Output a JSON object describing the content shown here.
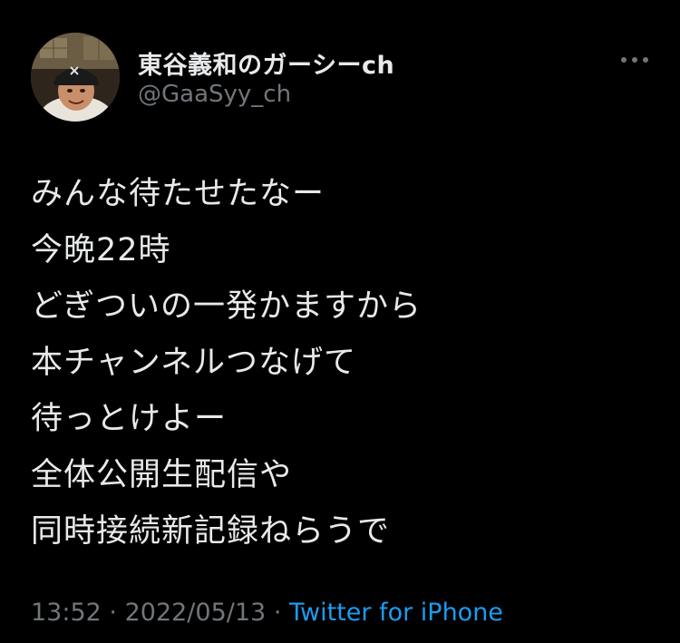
{
  "author": {
    "display_name": "東谷義和のガーシーch",
    "handle": "@GaaSyy_ch"
  },
  "tweet": {
    "lines": [
      "みんな待たせたなー",
      "今晩22時",
      "どぎついの一発かますから",
      "本チャンネルつなげて",
      "待っとけよー",
      "全体公開生配信や",
      "同時接続新記録ねらうで"
    ],
    "time": "13:52",
    "separator": "·",
    "date": "2022/05/13",
    "source": "Twitter for iPhone"
  },
  "icons": {
    "more": "more-horizontal-icon",
    "avatar": "avatar-photo"
  },
  "colors": {
    "background": "#000000",
    "text": "#e7e9ea",
    "secondary": "#71767b",
    "link": "#1d9bf0"
  }
}
